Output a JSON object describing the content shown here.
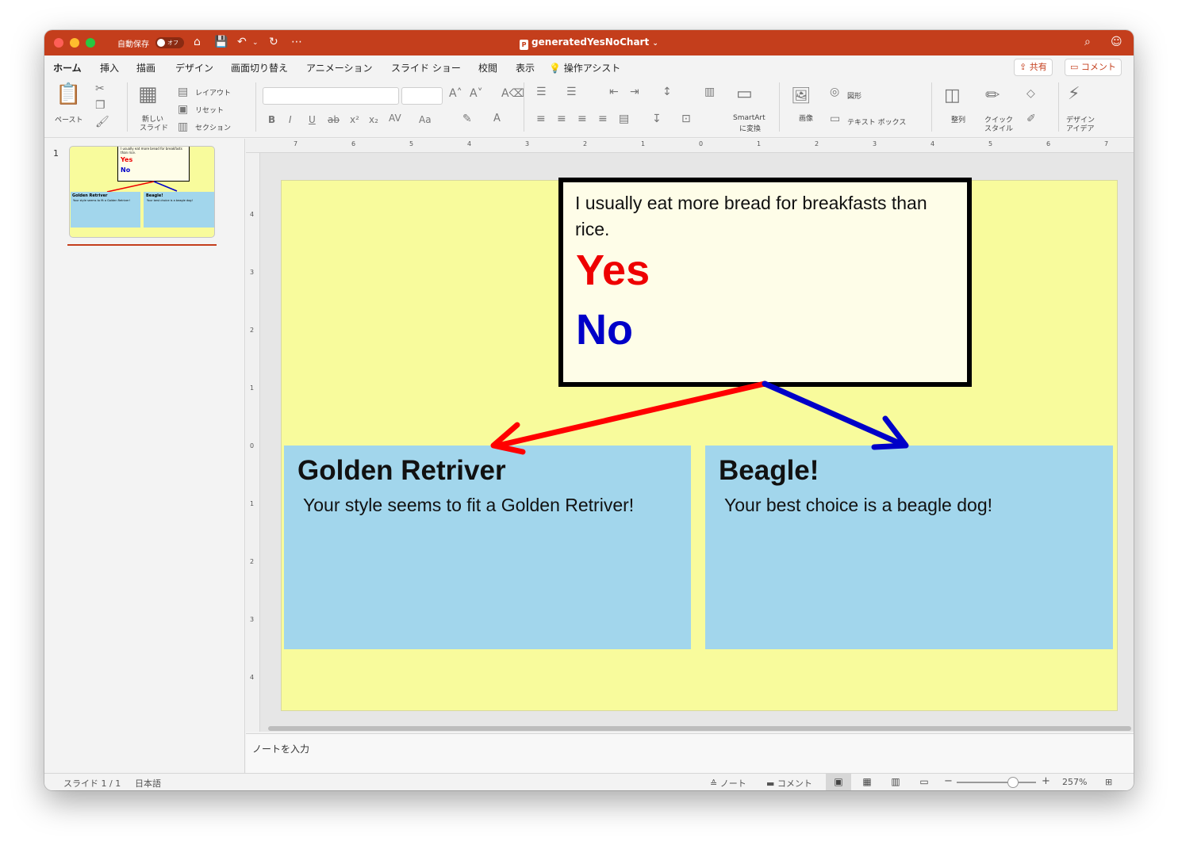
{
  "titlebar": {
    "autosave_label": "自動保存",
    "autosave_state": "オフ",
    "doc_title": "generatedYesNoChart",
    "doc_badge": "P"
  },
  "tabs": [
    {
      "label": "ホーム"
    },
    {
      "label": "挿入"
    },
    {
      "label": "描画"
    },
    {
      "label": "デザイン"
    },
    {
      "label": "画面切り替え"
    },
    {
      "label": "アニメーション"
    },
    {
      "label": "スライド ショー"
    },
    {
      "label": "校閲"
    },
    {
      "label": "表示"
    },
    {
      "label": "操作アシスト"
    }
  ],
  "share": {
    "label": "共有"
  },
  "comment": {
    "label": "コメント"
  },
  "ribbon": {
    "paste": "ペースト",
    "new_slide_1": "新しい",
    "new_slide_2": "スライド",
    "layout": "レイアウト",
    "reset": "リセット",
    "section": "セクション",
    "smartart_1": "SmartArt",
    "smartart_2": "に変換",
    "picture": "画像",
    "shapes": "図形",
    "textbox": "テキスト ボックス",
    "arrange": "整列",
    "quick_style_1": "クイック",
    "quick_style_2": "スタイル",
    "design_ideas_1": "デザイン",
    "design_ideas_2": "アイデア"
  },
  "thumbnail": {
    "number": "1"
  },
  "ruler": {
    "h_ticks": [
      "7",
      "6",
      "5",
      "4",
      "3",
      "2",
      "1",
      "0",
      "1",
      "2",
      "3",
      "4",
      "5",
      "6",
      "7"
    ],
    "v_ticks": [
      "4",
      "3",
      "2",
      "1",
      "0",
      "1",
      "2",
      "3",
      "4"
    ]
  },
  "slide": {
    "question": "I usually eat more bread for breakfasts than rice.",
    "yes": "Yes",
    "no": "No",
    "left_title": "Golden Retriver",
    "left_body": "Your style seems to fit a Golden Retriver!",
    "right_title": "Beagle!",
    "right_body": "Your best choice is a beagle dog!",
    "colors": {
      "background": "#f8fb9c",
      "question_fill": "#fefde8",
      "answer_fill": "#a2d6ec",
      "yes": "#ee0000",
      "no": "#0000c8"
    }
  },
  "notes": {
    "placeholder": "ノートを入力"
  },
  "statusbar": {
    "slide_count": "スライド 1 / 1",
    "language": "日本語",
    "notes_label": "ノート",
    "comments_label": "コメント",
    "zoom": "257%"
  }
}
